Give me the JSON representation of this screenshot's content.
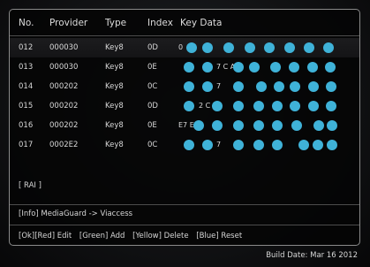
{
  "columns": {
    "no": "No.",
    "provider": "Provider",
    "type": "Type",
    "index": "Index",
    "key_data": "Key Data"
  },
  "rows": [
    {
      "no": "012",
      "provider": "000030",
      "type": "Key8",
      "index": "0D",
      "key_data": "0"
    },
    {
      "no": "013",
      "provider": "000030",
      "type": "Key8",
      "index": "0E",
      "key_data": "7 C A"
    },
    {
      "no": "014",
      "provider": "000202",
      "type": "Key8",
      "index": "0C",
      "key_data": "7"
    },
    {
      "no": "015",
      "provider": "000202",
      "type": "Key8",
      "index": "0D",
      "key_data": "2 C"
    },
    {
      "no": "016",
      "provider": "000202",
      "type": "Key8",
      "index": "0E",
      "key_data": "E7 E"
    },
    {
      "no": "017",
      "provider": "0002E2",
      "type": "Key8",
      "index": "0C",
      "key_data": "7"
    }
  ],
  "status": {
    "rai": "[ RAI ]",
    "info": "[Info] MediaGuard -> Viaccess"
  },
  "key_hints": [
    "[Ok][Red] Edit",
    "[Green] Add",
    "[Yellow] Delete",
    "[Blue] Reset"
  ],
  "build_date": "Build Date: Mar 16 2012",
  "colors": {
    "redaction_blot": "#3fb2d8",
    "panel_border": "#8a8a8a",
    "selected_row": "#1a1a1c"
  }
}
